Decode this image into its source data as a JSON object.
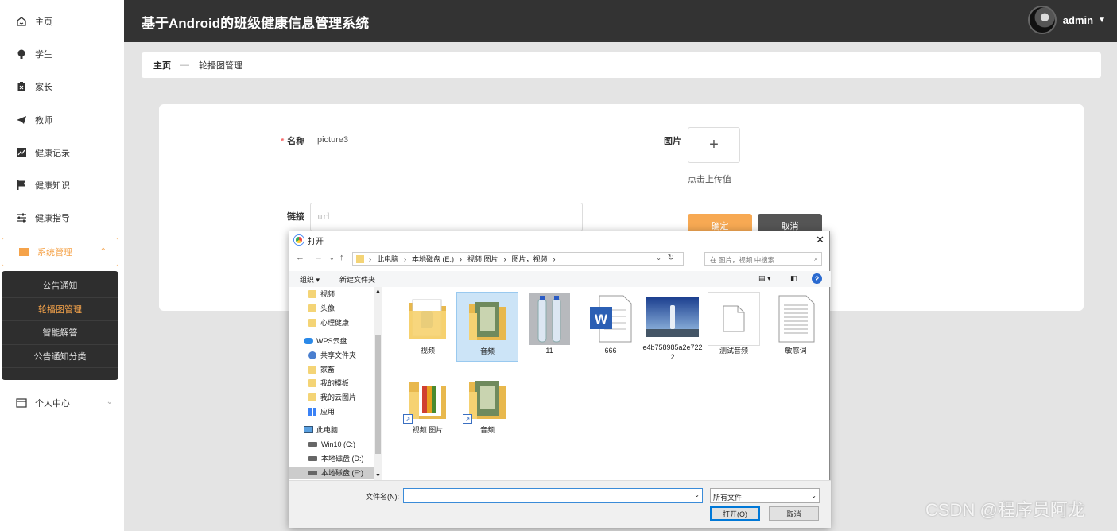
{
  "sidebar": {
    "items": [
      {
        "label": "主页",
        "icon": "home-icon"
      },
      {
        "label": "学生",
        "icon": "bulb-icon"
      },
      {
        "label": "家长",
        "icon": "clipboard-icon"
      },
      {
        "label": "教师",
        "icon": "paper-plane-icon"
      },
      {
        "label": "健康记录",
        "icon": "line-chart-icon"
      },
      {
        "label": "健康知识",
        "icon": "flag-icon"
      },
      {
        "label": "健康指导",
        "icon": "sliders-icon"
      },
      {
        "label": "系统管理",
        "icon": "system-icon"
      },
      {
        "label": "个人中心",
        "icon": "card-icon"
      }
    ],
    "submenu": [
      "公告通知",
      "轮播图管理",
      "智能解答",
      "公告通知分类"
    ]
  },
  "header": {
    "title": "基于Android的班级健康信息管理系统",
    "user": "admin"
  },
  "breadcrumb": {
    "home": "主页",
    "separator": "—",
    "current": "轮播图管理"
  },
  "form": {
    "name_label": "名称",
    "name_value": "picture3",
    "link_label": "链接",
    "link_placeholder": "url",
    "image_label": "图片",
    "upload_plus": "+",
    "upload_hint": "点击上传值",
    "confirm": "确定",
    "cancel": "取消"
  },
  "dialog": {
    "title": "打开",
    "path": [
      "此电脑",
      "本地磁盘 (E:)",
      "视频 图片",
      "图片，视频"
    ],
    "search_placeholder": "在 图片，视频 中搜索",
    "organize": "组织 ▾",
    "new_folder": "新建文件夹",
    "tree": [
      {
        "label": "视频",
        "type": "folder"
      },
      {
        "label": "头像",
        "type": "folder"
      },
      {
        "label": "心理健康",
        "type": "folder"
      },
      {
        "label": "WPS云盘",
        "type": "cloud"
      },
      {
        "label": "共享文件夹",
        "type": "share"
      },
      {
        "label": "家畜",
        "type": "folder"
      },
      {
        "label": "我的模板",
        "type": "folder"
      },
      {
        "label": "我的云图片",
        "type": "folder"
      },
      {
        "label": "应用",
        "type": "apps"
      },
      {
        "label": "此电脑",
        "type": "pc"
      },
      {
        "label": "Win10 (C:)",
        "type": "drive"
      },
      {
        "label": "本地磁盘 (D:)",
        "type": "drive"
      },
      {
        "label": "本地磁盘 (E:)",
        "type": "drive"
      }
    ],
    "files": [
      {
        "name": "视频",
        "kind": "folder-video"
      },
      {
        "name": "音频",
        "kind": "folder-photo"
      },
      {
        "name": "11",
        "kind": "image-bottles"
      },
      {
        "name": "666",
        "kind": "word-doc"
      },
      {
        "name": "e4b758985a2e7222",
        "kind": "image-sky"
      },
      {
        "name": "测试音频",
        "kind": "blank-file"
      },
      {
        "name": "敏感词",
        "kind": "text-file"
      },
      {
        "name": "视频 图片",
        "kind": "folder-shortcut-media"
      },
      {
        "name": "音频",
        "kind": "folder-shortcut-photo"
      }
    ],
    "filename_label": "文件名(N):",
    "filetype": "所有文件",
    "open_btn": "打开(O)",
    "cancel_btn": "取消"
  },
  "watermark": "CSDN @程序员阿龙",
  "colors": {
    "accent": "#f5a34a",
    "header_bg": "#333333",
    "sub_bg": "#2e2e2e",
    "cancel_bg": "#555555"
  }
}
